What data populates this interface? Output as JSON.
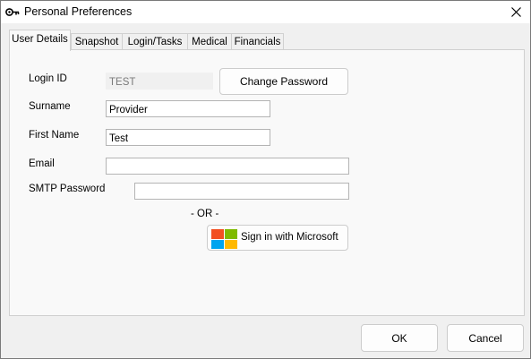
{
  "window": {
    "title": "Personal Preferences"
  },
  "tabs": [
    {
      "label": "User Details",
      "active": true
    },
    {
      "label": "Snapshot",
      "active": false
    },
    {
      "label": "Login/Tasks",
      "active": false
    },
    {
      "label": "Medical",
      "active": false
    },
    {
      "label": "Financials",
      "active": false
    }
  ],
  "form": {
    "login_id": {
      "label": "Login ID",
      "value": "TEST"
    },
    "change_password_label": "Change Password",
    "surname": {
      "label": "Surname",
      "value": "Provider"
    },
    "first_name": {
      "label": "First Name",
      "value": "Test"
    },
    "email": {
      "label": "Email",
      "value": ""
    },
    "smtp_password": {
      "label": "SMTP Password",
      "value": ""
    },
    "or_separator": "- OR -",
    "microsoft_signin_label": "Sign in with Microsoft"
  },
  "footer": {
    "ok_label": "OK",
    "cancel_label": "Cancel"
  },
  "colors": {
    "ms_red": "#f25022",
    "ms_green": "#7fba00",
    "ms_blue": "#00a4ef",
    "ms_yellow": "#ffb900"
  }
}
